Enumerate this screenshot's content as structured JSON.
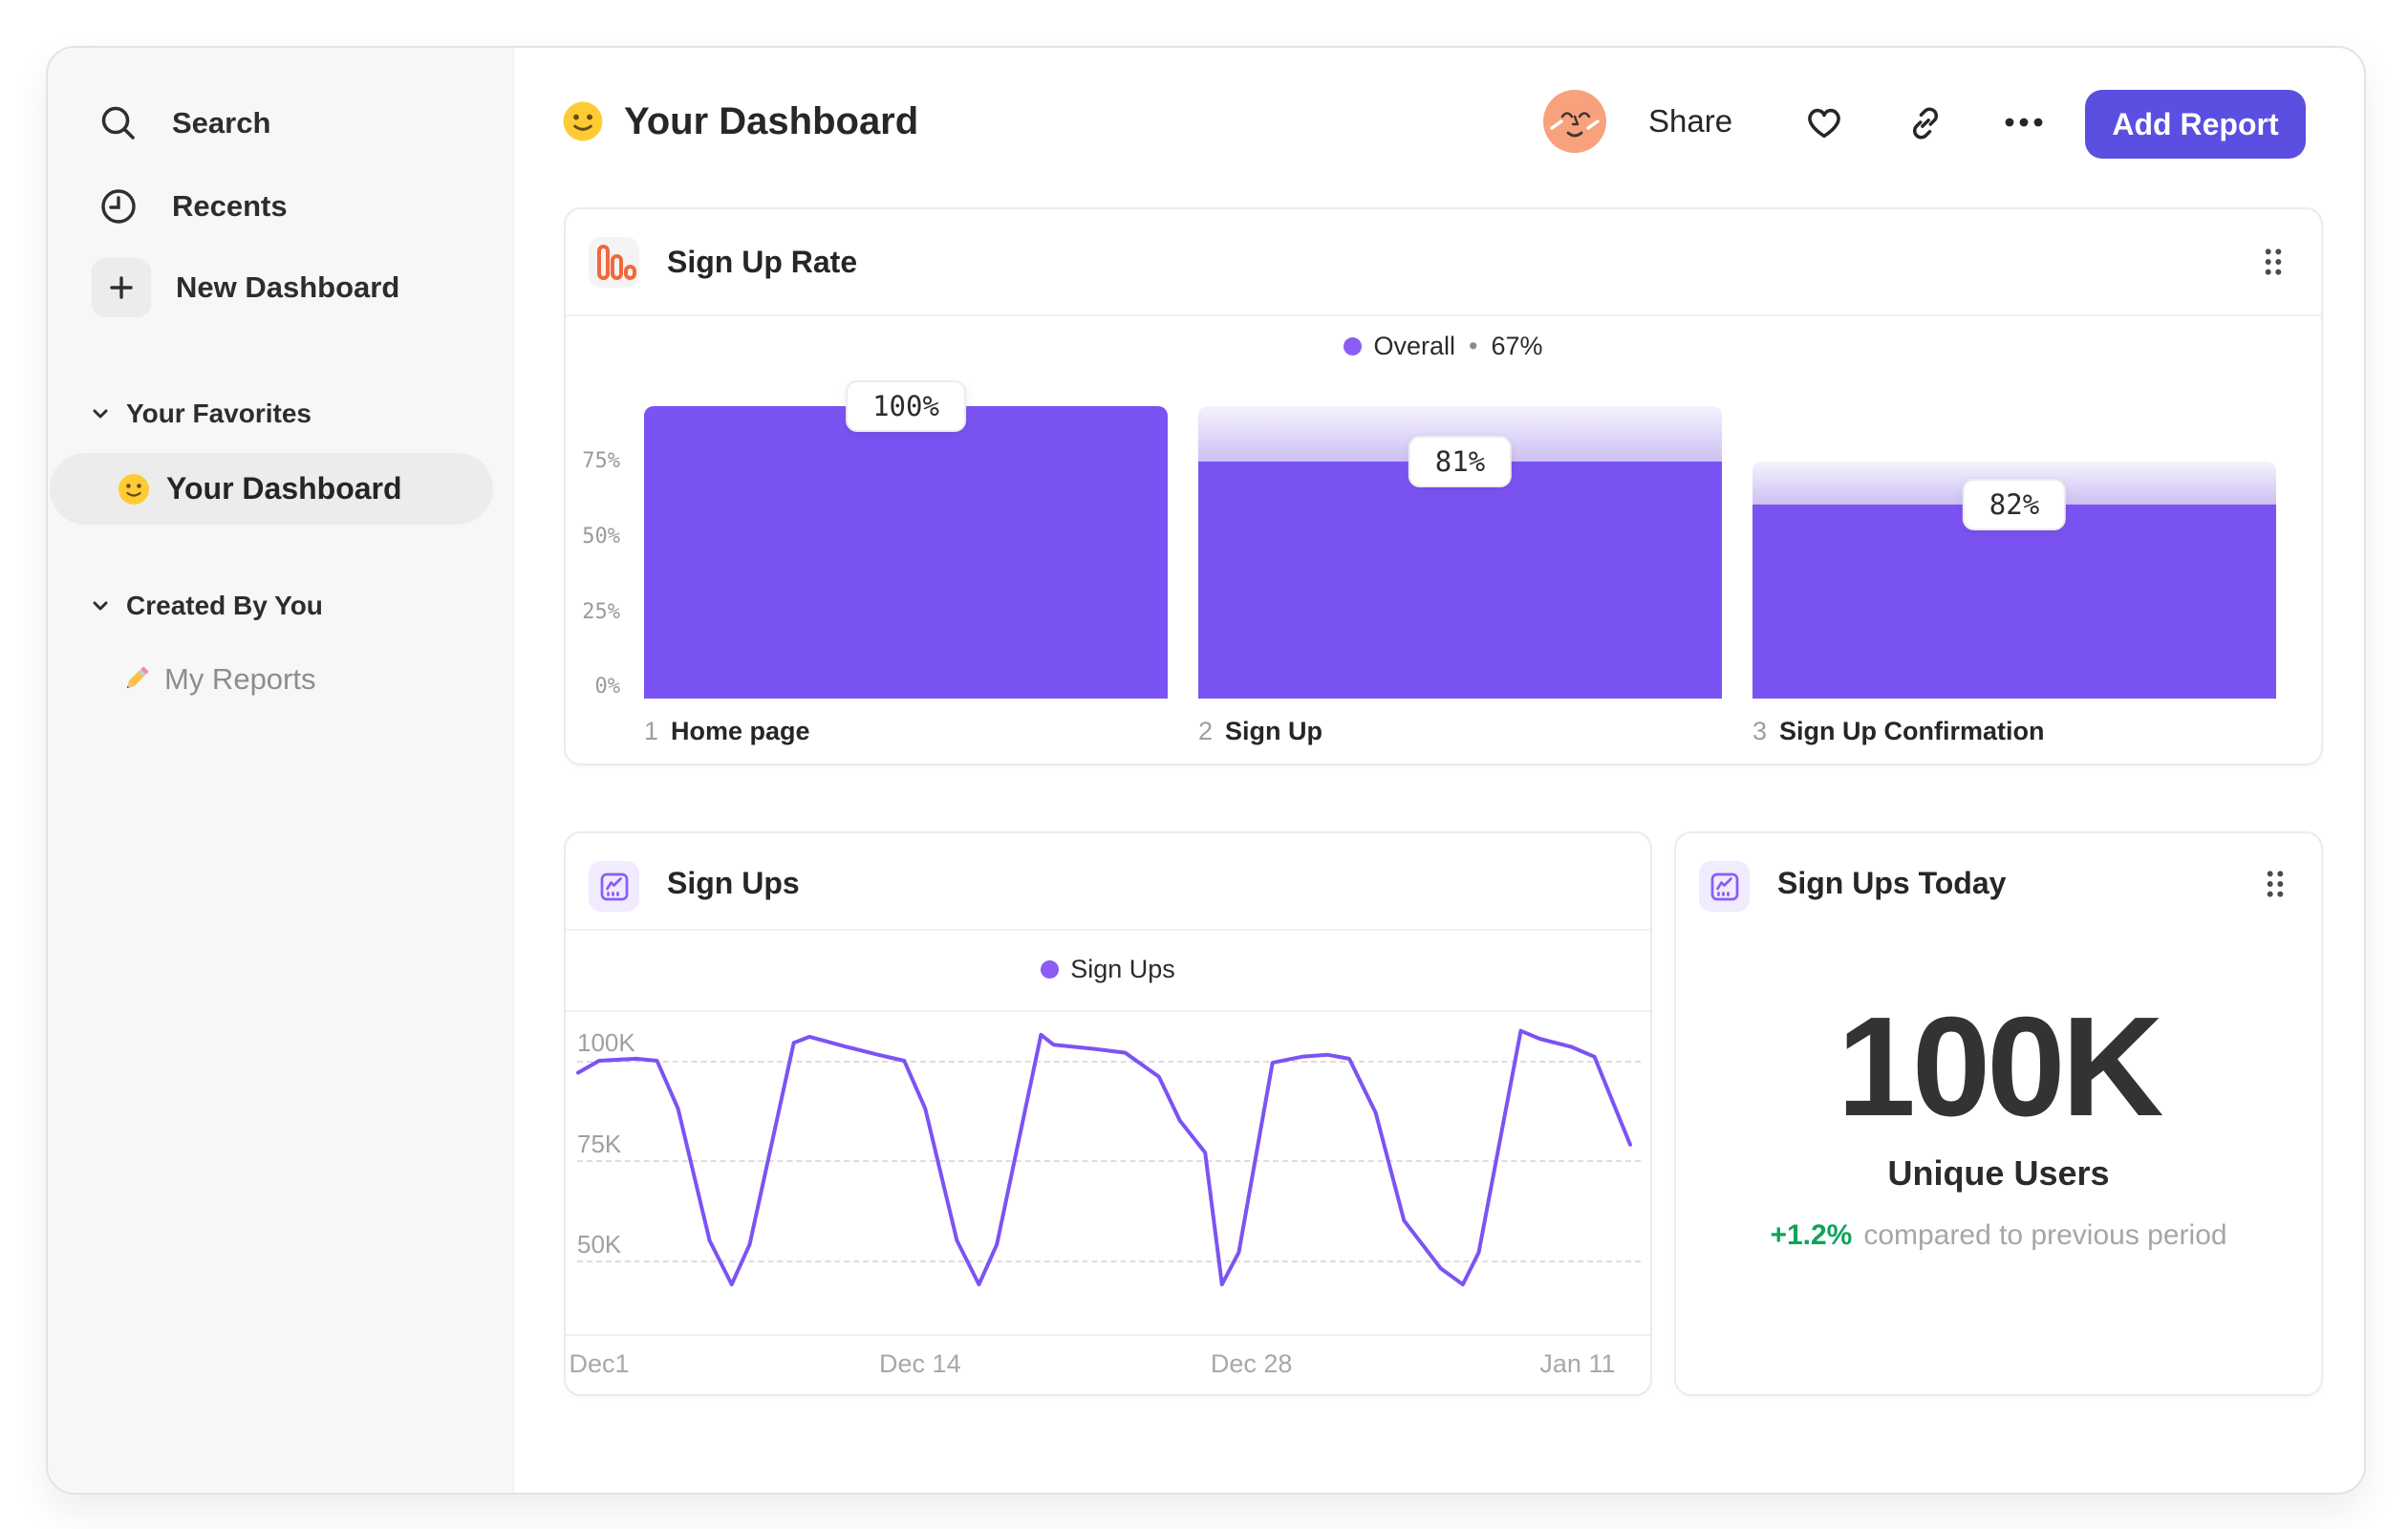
{
  "theme": {
    "accent_purple": "#7C53F3",
    "legend_purple": "#8B5CF6",
    "button_indigo": "#5A4FE0",
    "ghost_top": "#F5F2FE",
    "ghost_bottom": "#CCC0F2",
    "icon_orange": "#F2683C",
    "green": "#0FA35C",
    "sidebar_bg": "#F7F7F7",
    "pill_bg": "#ECECEC",
    "avatar_peach": "#F7A27D"
  },
  "sidebar": {
    "nav": [
      {
        "icon": "search-icon",
        "label": "Search"
      },
      {
        "icon": "clock-icon",
        "label": "Recents"
      },
      {
        "icon": "plus-icon",
        "label": "New Dashboard"
      }
    ],
    "sections": [
      {
        "title": "Your Favorites",
        "icon": "chevron-down-icon",
        "items": [
          {
            "icon": "smiley-emoji",
            "label": "Your Dashboard",
            "selected": true
          }
        ]
      },
      {
        "title": "Created By You",
        "icon": "chevron-down-icon",
        "items": [
          {
            "icon": "pencil-emoji",
            "label": "My Reports",
            "selected": false
          }
        ]
      }
    ]
  },
  "header": {
    "title_icon": "smiley-emoji",
    "title": "Your Dashboard",
    "share_label": "Share",
    "action_icons": [
      "avatar",
      "heart-icon",
      "link-icon",
      "ellipsis-icon"
    ],
    "add_report_label": "Add Report"
  },
  "cards": {
    "signup_rate": {
      "icon": "funnel-icon",
      "title": "Sign Up Rate",
      "legend_label": "Overall",
      "legend_sep": "•",
      "legend_value": "67%"
    },
    "signups": {
      "icon": "line-chart-icon",
      "title": "Sign Ups",
      "legend_label": "Sign Ups"
    },
    "today": {
      "icon": "line-chart-icon",
      "title": "Sign Ups Today",
      "value": "100K",
      "subtitle": "Unique Users",
      "delta": "+1.2%",
      "delta_note": "compared to previous period"
    }
  },
  "chart_data": [
    {
      "type": "bar",
      "subtype": "funnel",
      "title": "Sign Up Rate",
      "legend": "Overall • 67%",
      "categories": [
        "Home page",
        "Sign Up",
        "Sign Up Confirmation"
      ],
      "step_numbers": [
        "1",
        "2",
        "3"
      ],
      "step_conversion_labels": [
        "100%",
        "81%",
        "82%"
      ],
      "overall_percent": [
        100,
        81,
        66.4
      ],
      "yticks": [
        "75%",
        "50%",
        "25%",
        "0%"
      ],
      "ylim": [
        0,
        100
      ],
      "grid": false,
      "legend_position": "top-center"
    },
    {
      "type": "line",
      "title": "Sign Ups",
      "legend": "Sign Ups",
      "ylabel": "",
      "xlabel": "",
      "ylim": [
        40,
        110
      ],
      "grid": "dashed-horizontal",
      "legend_position": "top-center",
      "yticks": [
        {
          "label": "100K",
          "value": 100
        },
        {
          "label": "75K",
          "value": 75
        },
        {
          "label": "50K",
          "value": 50
        }
      ],
      "x_ticks": [
        {
          "label": "Dec1",
          "frac": 0.02
        },
        {
          "label": "Dec 14",
          "frac": 0.325
        },
        {
          "label": "Dec 28",
          "frac": 0.64
        },
        {
          "label": "Jan 11",
          "frac": 0.95
        }
      ],
      "points_unit": "thousands of sign ups, x = fraction of Dec 1 – Jan 11 range",
      "points": [
        [
          0.0,
          97
        ],
        [
          0.02,
          100
        ],
        [
          0.055,
          100.5
        ],
        [
          0.075,
          100
        ],
        [
          0.095,
          88
        ],
        [
          0.125,
          55
        ],
        [
          0.146,
          44
        ],
        [
          0.163,
          54
        ],
        [
          0.205,
          104.5
        ],
        [
          0.22,
          106
        ],
        [
          0.255,
          103.5
        ],
        [
          0.285,
          101.5
        ],
        [
          0.31,
          100
        ],
        [
          0.33,
          88
        ],
        [
          0.36,
          55
        ],
        [
          0.381,
          44
        ],
        [
          0.398,
          54
        ],
        [
          0.44,
          106.5
        ],
        [
          0.452,
          104
        ],
        [
          0.49,
          103
        ],
        [
          0.52,
          102
        ],
        [
          0.552,
          96
        ],
        [
          0.572,
          85
        ],
        [
          0.596,
          77
        ],
        [
          0.612,
          44
        ],
        [
          0.628,
          52
        ],
        [
          0.66,
          99.5
        ],
        [
          0.688,
          101
        ],
        [
          0.712,
          101.5
        ],
        [
          0.733,
          100.5
        ],
        [
          0.758,
          87
        ],
        [
          0.785,
          60
        ],
        [
          0.82,
          48
        ],
        [
          0.841,
          44
        ],
        [
          0.856,
          52
        ],
        [
          0.896,
          107.5
        ],
        [
          0.914,
          105.5
        ],
        [
          0.944,
          103.5
        ],
        [
          0.966,
          101
        ],
        [
          1.0,
          79
        ]
      ]
    }
  ]
}
